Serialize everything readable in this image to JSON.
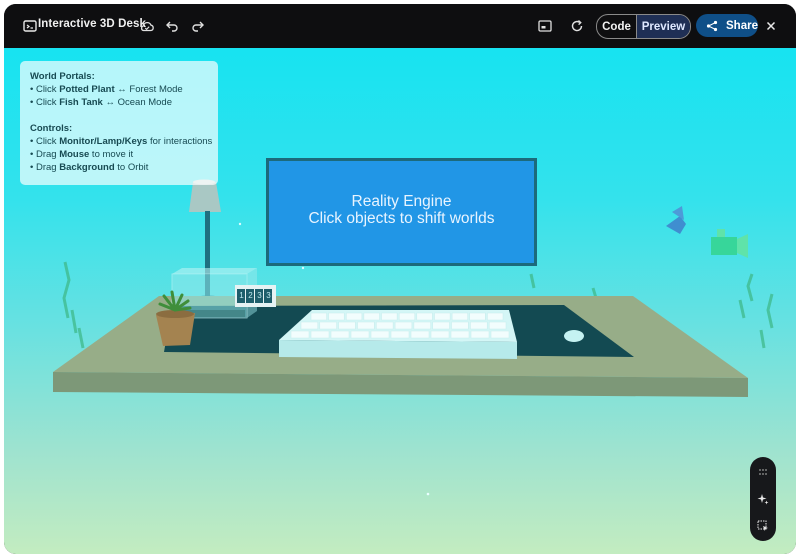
{
  "app": {
    "title": "Interactive 3D Desk",
    "code_tab": "Code",
    "preview_tab": "Preview",
    "share_label": "Share"
  },
  "toolbar_icons": [
    "app-icon",
    "cloud-icon",
    "undo-icon",
    "redo-icon",
    "preview-window-icon",
    "refresh-icon",
    "share-icon",
    "close-icon"
  ],
  "info_panel": {
    "portals_heading": "World Portals:",
    "portal_lines": [
      {
        "prefix": "• Click ",
        "bold": "Potted Plant",
        "suffix": " ↔ Forest Mode"
      },
      {
        "prefix": "• Click ",
        "bold": "Fish Tank",
        "suffix": " ↔ Ocean Mode"
      }
    ],
    "controls_heading": "Controls:",
    "control_lines": [
      {
        "prefix": "• Click ",
        "bold": "Monitor/Lamp/Keys",
        "suffix": " for interactions"
      },
      {
        "prefix": "• Drag ",
        "bold": "Mouse",
        "suffix": " to move it"
      },
      {
        "prefix": "• Drag ",
        "bold": "Background",
        "suffix": " to Orbit"
      }
    ]
  },
  "monitor": {
    "line1": "Reality Engine",
    "line2": "Click objects to shift worlds"
  },
  "clock_digits": [
    "1",
    "2",
    "3",
    "3"
  ],
  "colors": {
    "scene_top": "#17e3f1",
    "scene_bottom": "#c3ecc0",
    "monitor_screen": "#2196e6",
    "desk_top": "#97ad88",
    "mat": "#134a52",
    "share_button": "#0f4f88"
  },
  "side_icons": [
    "drag-handle-icon",
    "sparkle-icon",
    "select-area-icon"
  ]
}
